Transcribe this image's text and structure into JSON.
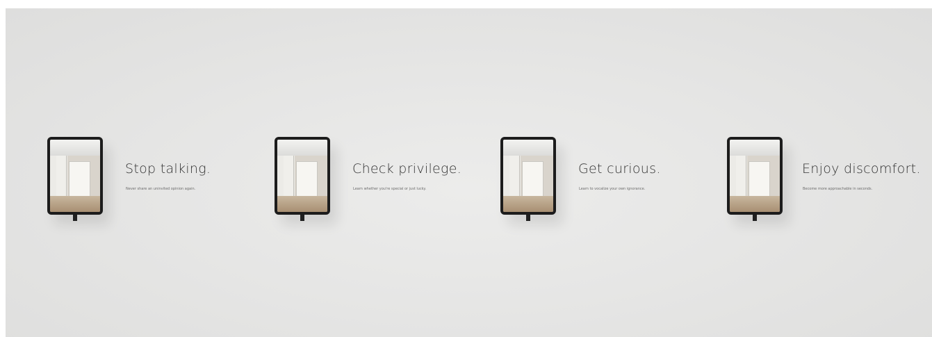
{
  "exhibit": {
    "pieces": [
      {
        "title": "Stop talking.",
        "caption": "Never share an uninvited opinion again."
      },
      {
        "title": "Check privilege.",
        "caption": "Learn whether you're special or just lucky."
      },
      {
        "title": "Get curious.",
        "caption": "Learn to vocalize your own ignorance."
      },
      {
        "title": "Enjoy discomfort.",
        "caption": "Become more approachable in seconds."
      }
    ]
  },
  "colors": {
    "wall": "#e6e6e5",
    "frame": "#1c1c1c",
    "text": "#333333"
  }
}
